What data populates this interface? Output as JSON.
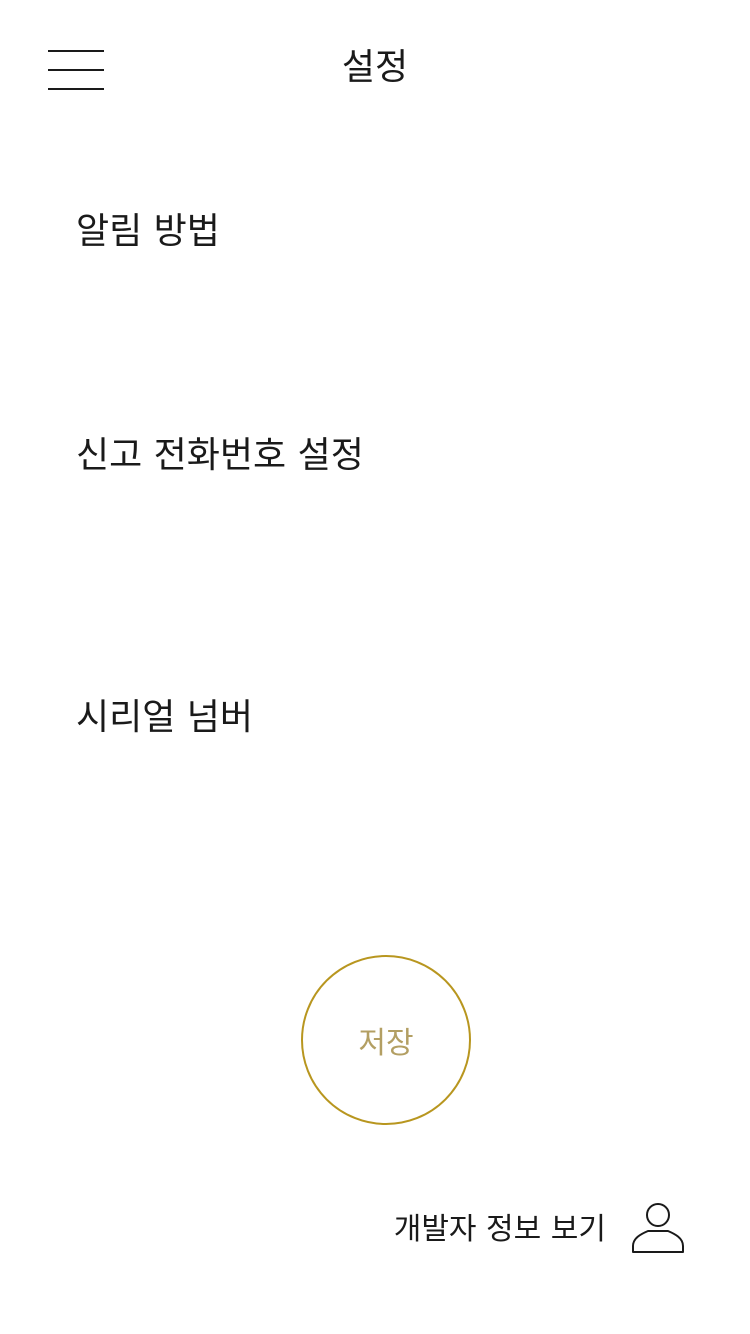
{
  "header": {
    "title": "설정",
    "menu_icon": "hamburger-menu-icon"
  },
  "settings": {
    "items": [
      {
        "label": "알림 방법"
      },
      {
        "label": "신고 전화번호 설정"
      },
      {
        "label": "시리얼 넘버"
      }
    ]
  },
  "actions": {
    "save_label": "저장",
    "save_color": "#b8961f",
    "developer_label": "개발자 정보 보기",
    "developer_icon": "user-icon"
  }
}
